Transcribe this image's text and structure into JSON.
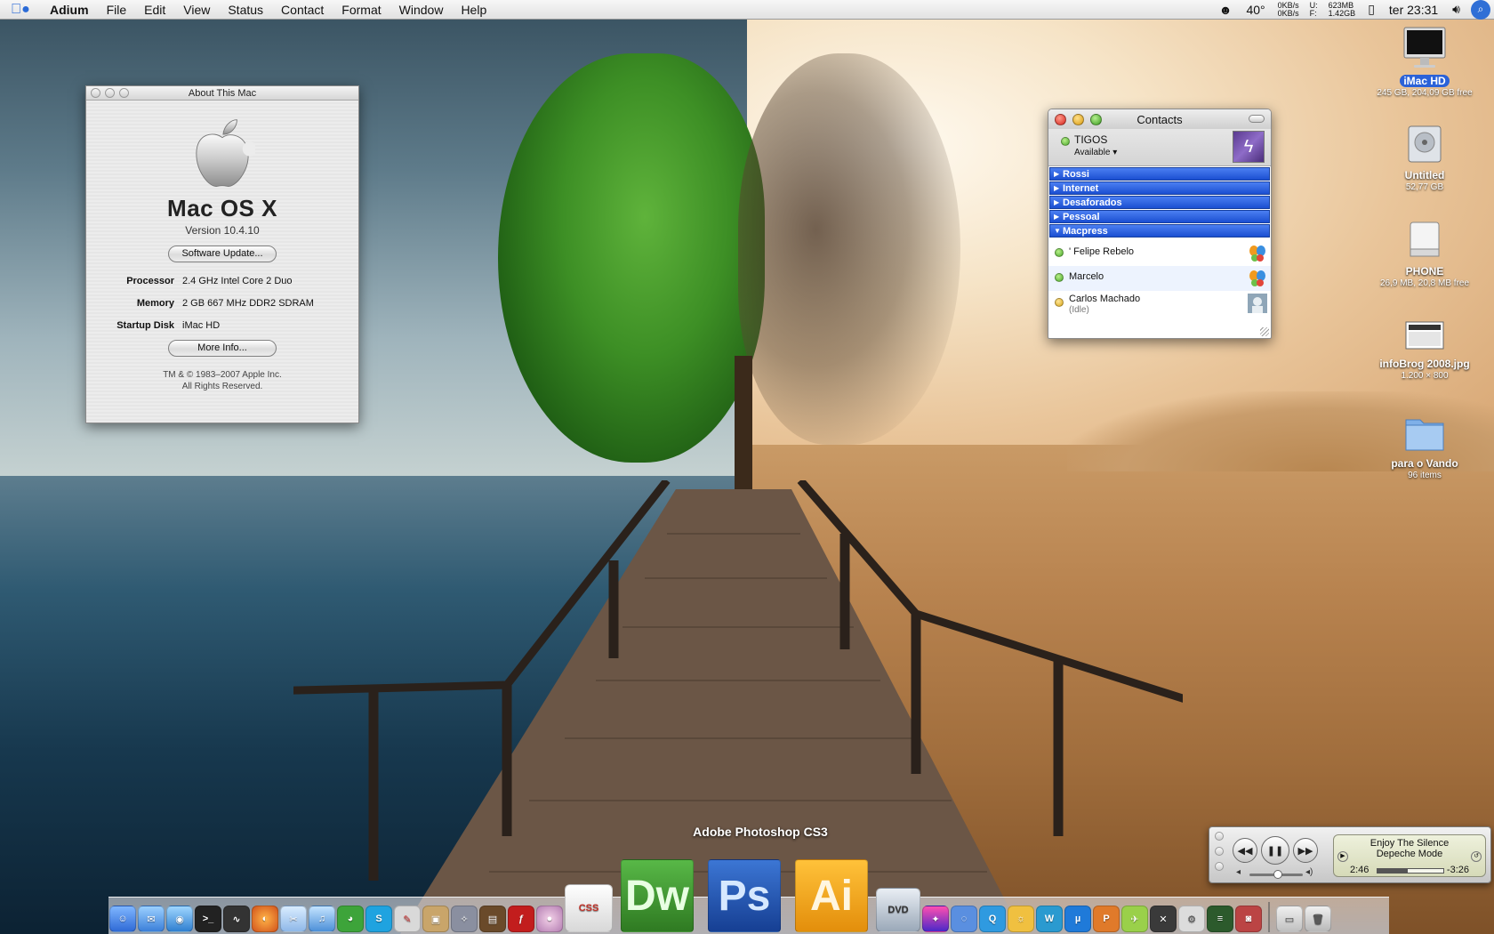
{
  "menubar": {
    "app_name": "Adium",
    "menus": [
      "File",
      "Edit",
      "View",
      "Status",
      "Contact",
      "Format",
      "Window",
      "Help"
    ],
    "temperature": "40°",
    "net_in": "0KB/s",
    "net_out": "0KB/s",
    "mem_used_label": "U:",
    "mem_free_label": "F:",
    "mem_used": "623MB",
    "mem_free": "1.42GB",
    "clock": "ter 23:31"
  },
  "about": {
    "window_title": "About This Mac",
    "os_name": "Mac OS X",
    "version": "Version 10.4.10",
    "software_update_button": "Software Update...",
    "rows": [
      {
        "label": "Processor",
        "value": "2.4 GHz Intel Core 2 Duo"
      },
      {
        "label": "Memory",
        "value": "2 GB 667 MHz DDR2 SDRAM"
      },
      {
        "label": "Startup Disk",
        "value": "iMac HD"
      }
    ],
    "more_info_button": "More Info...",
    "legal_1": "TM & © 1983–2007 Apple Inc.",
    "legal_2": "All Rights Reserved."
  },
  "contacts": {
    "title": "Contacts",
    "account_name": "TIGOS",
    "account_status": "Available",
    "groups": [
      "Rossi",
      "Internet",
      "Desaforados",
      "Pessoal",
      "Macpress"
    ],
    "buddies": [
      {
        "name": "' Felipe Rebelo",
        "sub": ""
      },
      {
        "name": "Marcelo",
        "sub": ""
      },
      {
        "name": "Carlos Machado",
        "sub": "(Idle)"
      }
    ]
  },
  "desktop_icons": [
    {
      "label": "iMac HD",
      "sub": "245 GB, 204,09 GB free"
    },
    {
      "label": "Untitled",
      "sub": "52,77 GB"
    },
    {
      "label": "PHONE",
      "sub": "26,9 MB, 20,8 MB free"
    },
    {
      "label": "infoBrog 2008.jpg",
      "sub": "1.200 × 800"
    },
    {
      "label": "para o Vando",
      "sub": "96 items"
    }
  ],
  "itunes": {
    "track": "Enjoy The Silence",
    "artist": "Depeche Mode",
    "elapsed": "2:46",
    "remaining": "-3:26",
    "progress": 0.46,
    "volume": 0.55
  },
  "dock": {
    "hover_label": "Adobe Photoshop CS3",
    "dw": "Dw",
    "ps": "Ps",
    "ai": "Ai",
    "css": "CSS"
  },
  "colors": {
    "selection_blue": "#2b62d8",
    "group_blue": "#1b4fd1",
    "dreamweaver": "#3a8f2b",
    "photoshop": "#1d4fb0",
    "illustrator": "#f2a514"
  }
}
